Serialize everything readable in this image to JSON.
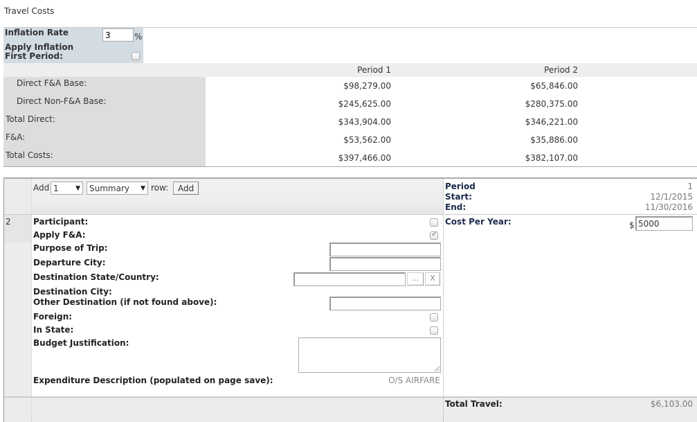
{
  "page": {
    "title": "Travel Costs"
  },
  "inflation": {
    "rate_label": "Inflation Rate",
    "rate_value": "3",
    "percent_symbol": "%",
    "apply_label_line1": "Apply Inflation",
    "apply_label_line2": "First Period:",
    "apply_checked": false
  },
  "summary": {
    "periods": [
      "Period 1",
      "Period 2"
    ],
    "rows": [
      {
        "label": "Direct F&A Base:",
        "values": [
          "$98,279.00",
          "$65,846.00"
        ],
        "indent": true
      },
      {
        "label": "Direct Non-F&A Base:",
        "values": [
          "$245,625.00",
          "$280,375.00"
        ],
        "indent": true
      },
      {
        "label": "Total Direct:",
        "values": [
          "$343,904.00",
          "$346,221.00"
        ],
        "indent": false
      },
      {
        "label": "F&A:",
        "values": [
          "$53,562.00",
          "$35,886.00"
        ],
        "indent": false
      },
      {
        "label": "Total Costs:",
        "values": [
          "$397,466.00",
          "$382,107.00"
        ],
        "indent": false
      }
    ]
  },
  "toolbar": {
    "add_text": "Add",
    "count_value": "1",
    "type_value": "Summary",
    "row_text": "row:",
    "add_button": "Add",
    "dropdown_arrow": "▼"
  },
  "item": {
    "row_number": "2",
    "fields": {
      "participant": "Participant:",
      "apply_fa": "Apply F&A:",
      "purpose": "Purpose of Trip:",
      "departure_city": "Departure City:",
      "destination_state": "Destination State/Country:",
      "destination_city": "Destination City:",
      "other_destination": "Other Destination (if not found above):",
      "foreign": "Foreign:",
      "in_state": "In State:",
      "budget_justification": "Budget Justification:",
      "expenditure_description": "Expenditure Description (populated on page save):"
    },
    "values": {
      "participant_checked": false,
      "apply_fa_checked": true,
      "purpose": "",
      "departure_city": "",
      "destination_state": "",
      "other_destination": "",
      "foreign_checked": false,
      "in_state_checked": false,
      "budget_justification": "",
      "expenditure_description": "O/S AIRFARE"
    },
    "lookup_button": "...",
    "clear_button": "X"
  },
  "period_info": {
    "period_label": "Period",
    "period_value": "1",
    "start_label": "Start:",
    "start_value": "12/1/2015",
    "end_label": "End:",
    "end_value": "11/30/2016",
    "cost_per_year_label": "Cost Per Year:",
    "currency_symbol": "$",
    "cost_per_year_value": "5000"
  },
  "footer": {
    "total_label": "Total Travel:",
    "total_value": "$6,103.00"
  }
}
